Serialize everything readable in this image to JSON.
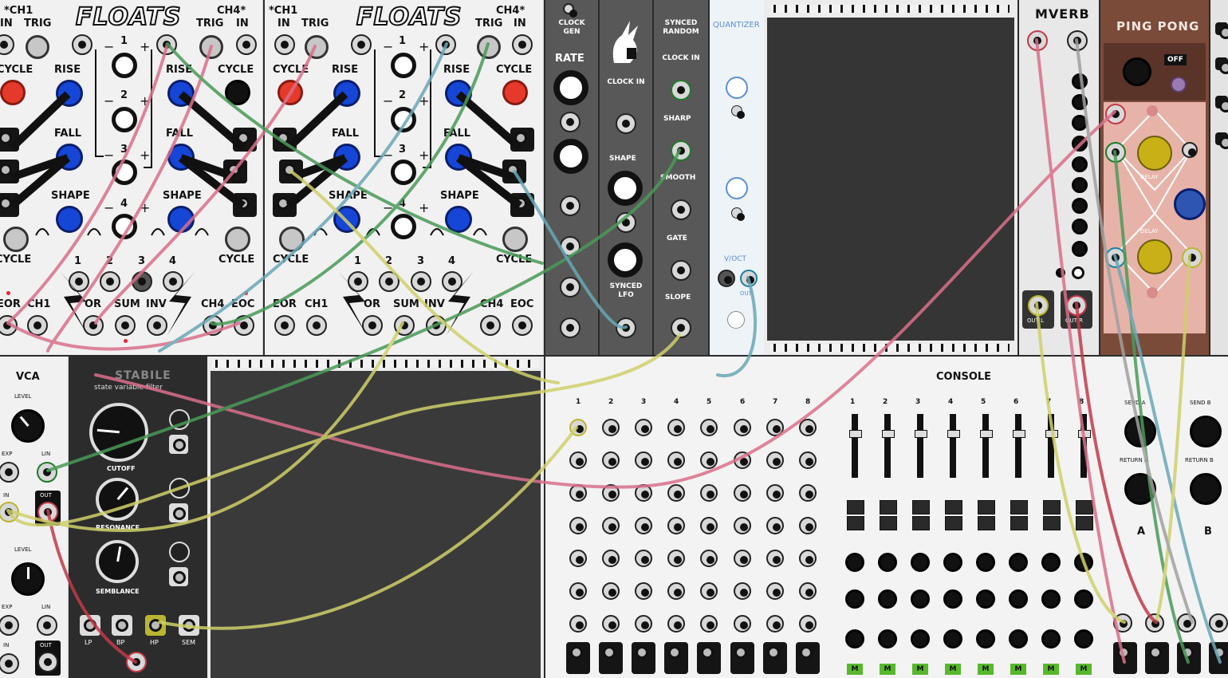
{
  "floats": [
    {
      "logo": "FLOATS",
      "ch1_header": "*CH1",
      "ch1_in": "IN",
      "ch1_trig": "TRIG",
      "ch4_header": "CH4*",
      "ch4_trig": "TRIG",
      "ch4_in": "IN",
      "cycle": "CYCLE",
      "rise": "RISE",
      "fall": "FALL",
      "shape": "SHAPE",
      "nums": [
        "1",
        "2",
        "3",
        "4"
      ],
      "eor": "EOR",
      "ch1": "CH1",
      "or": "OR",
      "sum": "SUM",
      "inv": "INV",
      "ch4": "CH4",
      "eoc": "EOC"
    },
    {
      "logo": "FLOATS",
      "ch1_header": "*CH1",
      "ch1_in": "IN",
      "ch1_trig": "TRIG",
      "ch4_header": "CH4*",
      "ch4_trig": "TRIG",
      "ch4_in": "IN",
      "cycle": "CYCLE",
      "rise": "RISE",
      "fall": "FALL",
      "shape": "SHAPE",
      "nums": [
        "1",
        "2",
        "3",
        "4"
      ],
      "eor": "EOR",
      "ch1": "CH1",
      "or": "OR",
      "sum": "SUM",
      "inv": "INV",
      "ch4": "CH4",
      "eoc": "EOC"
    }
  ],
  "clock_gen": {
    "title": "CLOCK GEN",
    "rate": "RATE"
  },
  "synced_lfo": {
    "clock_in": "CLOCK IN",
    "shape": "SHAPE",
    "title": "SYNCED LFO"
  },
  "synced_random": {
    "title": "SYNCED RANDOM",
    "clock_in": "CLOCK IN",
    "sharp": "SHARP",
    "smooth": "SMOOTH",
    "gate": "GATE",
    "slope": "SLOPE"
  },
  "quantizer": {
    "title": "Quantizer",
    "voct": "V/OCT",
    "out": "Out"
  },
  "mverb": {
    "title": "MVERB",
    "out_l": "OUT L",
    "out_r": "OUT R"
  },
  "ping_pong": {
    "title": "PING PONG",
    "off": "OFF",
    "delay": "Delay"
  },
  "vca": {
    "title": "VCA",
    "level1": "LEVEL",
    "level2": "LEVEL",
    "exp": "EXP",
    "lin": "LIN",
    "in": "IN",
    "out": "OUT"
  },
  "stabile": {
    "title": "STABILE",
    "subtitle": "state variable filter",
    "cutoff": "CUTOFF",
    "resonance": "RESONANCE",
    "semblance": "SEMBLANCE",
    "lp": "LP",
    "bp": "BP",
    "hp": "HP",
    "sem": "SEM"
  },
  "console": {
    "title": "CONSOLE",
    "channels": [
      "1",
      "2",
      "3",
      "4",
      "5",
      "6",
      "7",
      "8"
    ],
    "send_a": "SEND A",
    "return_a": "RETURN A",
    "send_b": "SEND B",
    "return_b": "RETURN B",
    "a": "A",
    "b": "B",
    "mute": "M"
  },
  "colors": {
    "cable_pink": "#d9708a",
    "cable_green": "#4a9a58",
    "cable_yellow": "#cfd06a",
    "cable_blue": "#6aa7b7",
    "cable_red": "#c23a4a",
    "panel_white": "#f1f1f1",
    "knob_blue": "#1646d6",
    "knob_red": "#e53a2b",
    "pingpong_brown": "#7b4b3a"
  }
}
